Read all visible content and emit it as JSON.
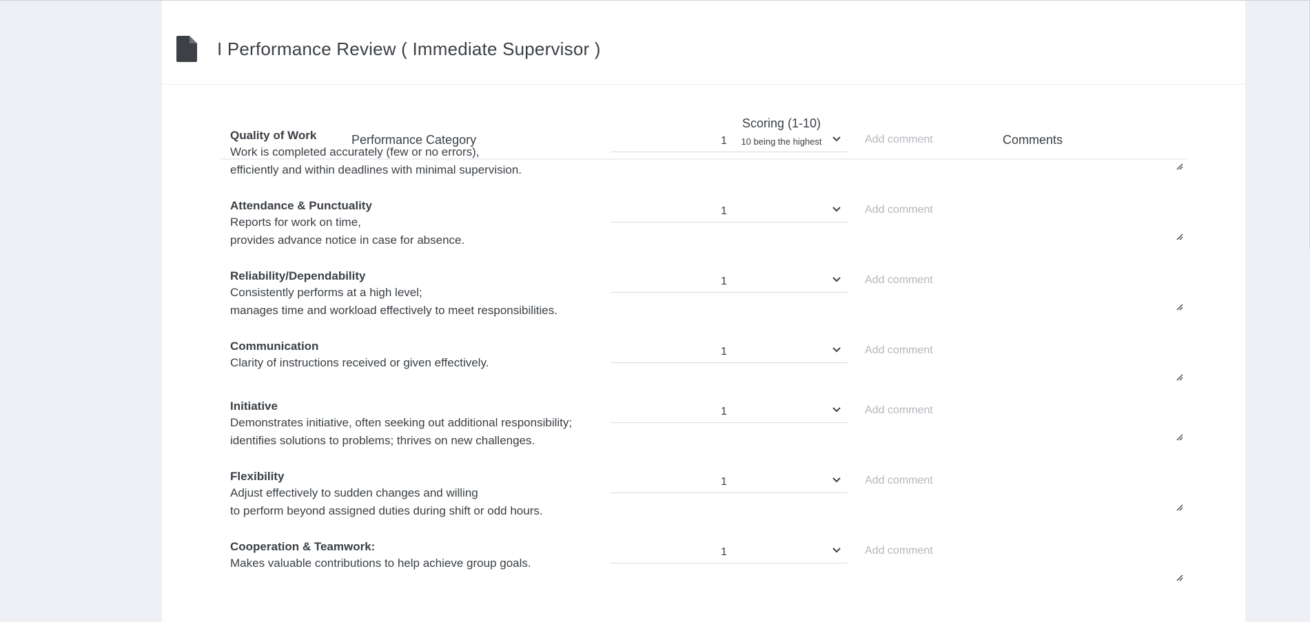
{
  "page": {
    "title": "I Performance Review ( Immediate Supervisor )",
    "icon": "file-icon"
  },
  "table": {
    "headers": {
      "category": "Performance Category",
      "scoring": "Scoring (1-10)",
      "scoring_note": "10 being the highest",
      "comments": "Comments"
    },
    "comment_placeholder": "Add comment",
    "rows": [
      {
        "title": "Quality of Work",
        "desc1": "Work is completed accurately (few or no errors),",
        "desc2": "efficiently and within deadlines with minimal supervision.",
        "score": "1"
      },
      {
        "title": "Attendance & Punctuality",
        "desc1": "Reports for work on time,",
        "desc2": "provides advance notice in case for absence.",
        "score": "1"
      },
      {
        "title": "Reliability/Dependability",
        "desc1": "Consistently performs at a high level;",
        "desc2": "manages time and workload effectively to meet responsibilities.",
        "score": "1"
      },
      {
        "title": "Communication",
        "desc1": "Clarity of instructions received or given effectively.",
        "desc2": "",
        "score": "1"
      },
      {
        "title": "Initiative",
        "desc1": "Demonstrates initiative, often seeking out additional responsibility;",
        "desc2": "identifies solutions to problems; thrives on new challenges.",
        "score": "1"
      },
      {
        "title": "Flexibility",
        "desc1": "Adjust effectively to sudden changes and willing",
        "desc2": "to perform beyond assigned duties during shift or odd hours.",
        "score": "1"
      },
      {
        "title": "Cooperation & Teamwork:",
        "desc1": "Makes valuable contributions to help achieve group goals.",
        "desc2": "",
        "score": "1"
      }
    ]
  },
  "colors": {
    "background": "#eef0f5",
    "card": "#ffffff",
    "text": "#3a3f44",
    "placeholder": "#b3b7bc"
  }
}
